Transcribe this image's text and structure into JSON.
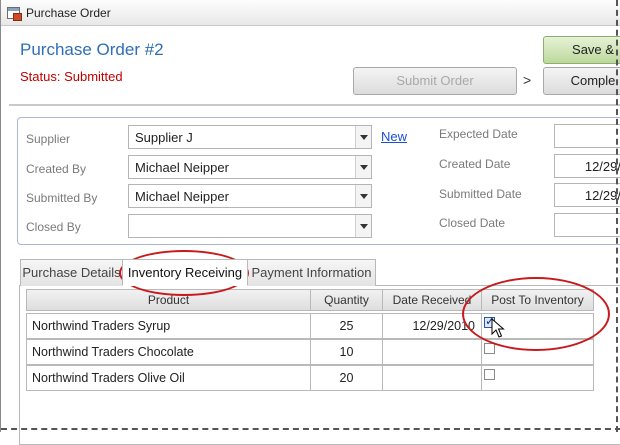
{
  "window": {
    "title": "Purchase Order"
  },
  "header": {
    "title": "Purchase Order #2",
    "status": "Status: Submitted",
    "save_label": "Save &",
    "submit_label": "Submit Order",
    "arrow": ">",
    "complete_label": "Comple"
  },
  "form": {
    "supplier_label": "Supplier",
    "supplier_value": "Supplier J",
    "new_link": "New",
    "created_by_label": "Created By",
    "created_by_value": "Michael Neipper",
    "submitted_by_label": "Submitted By",
    "submitted_by_value": "Michael Neipper",
    "closed_by_label": "Closed By",
    "closed_by_value": "",
    "expected_date_label": "Expected Date",
    "expected_date_value": "",
    "created_date_label": "Created Date",
    "created_date_value": "12/29/",
    "submitted_date_label": "Submitted Date",
    "submitted_date_value": "12/29/",
    "closed_date_label": "Closed Date",
    "closed_date_value": ""
  },
  "tabs": [
    {
      "label": "Purchase Details"
    },
    {
      "label": "Inventory Receiving"
    },
    {
      "label": "Payment Information"
    }
  ],
  "grid": {
    "columns": [
      "Product",
      "Quantity",
      "Date Received",
      "Post To Inventory"
    ],
    "rows": [
      {
        "product": "Northwind Traders Syrup",
        "quantity": "25",
        "date_received": "12/29/2010",
        "post_to_inventory": true
      },
      {
        "product": "Northwind Traders Chocolate",
        "quantity": "10",
        "date_received": "",
        "post_to_inventory": false
      },
      {
        "product": "Northwind Traders Olive Oil",
        "quantity": "20",
        "date_received": "",
        "post_to_inventory": false
      }
    ]
  },
  "colors": {
    "title_blue": "#2e6fb4",
    "status_red": "#c00000",
    "highlight_red": "#c8191c",
    "save_green": "#bcd99c"
  }
}
